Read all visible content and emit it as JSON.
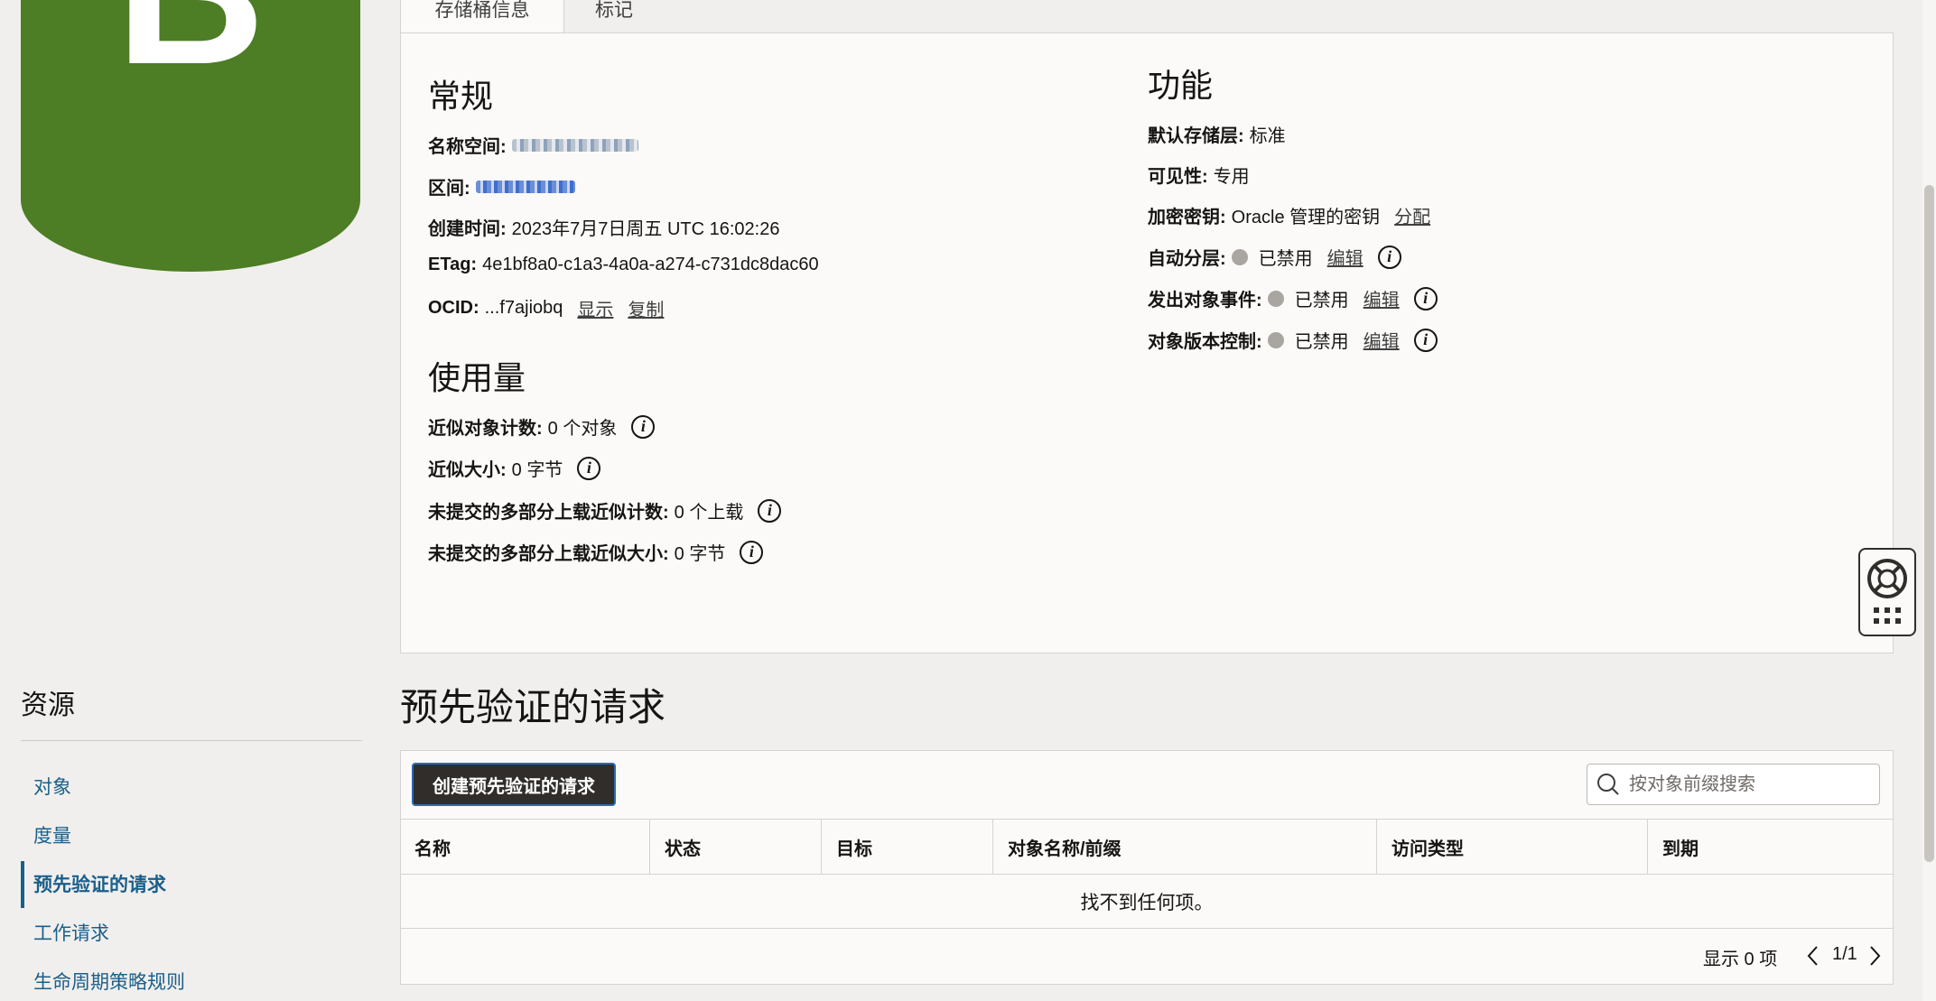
{
  "logo": {
    "letter": "B",
    "color": "#4d7d24"
  },
  "tabs": [
    {
      "label": "存储桶信息",
      "active": true
    },
    {
      "label": "标记",
      "active": false
    }
  ],
  "general": {
    "heading": "常规",
    "namespace_label": "名称空间:",
    "compartment_label": "区间:",
    "created_label": "创建时间:",
    "created_value": "2023年7月7日周五 UTC 16:02:26",
    "etag_label": "ETag:",
    "etag_value": "4e1bf8a0-c1a3-4a0a-a274-c731dc8dac60",
    "ocid_label": "OCID:",
    "ocid_value": "...f7ajiobq",
    "show_link": "显示",
    "copy_link": "复制"
  },
  "usage": {
    "heading": "使用量",
    "object_count_label": "近似对象计数:",
    "object_count_value": "0 个对象",
    "size_label": "近似大小:",
    "size_value": "0 字节",
    "multipart_count_label": "未提交的多部分上载近似计数:",
    "multipart_count_value": "0 个上载",
    "multipart_size_label": "未提交的多部分上载近似大小:",
    "multipart_size_value": "0 字节"
  },
  "features": {
    "heading": "功能",
    "storage_tier_label": "默认存储层:",
    "storage_tier_value": "标准",
    "visibility_label": "可见性:",
    "visibility_value": "专用",
    "encryption_label": "加密密钥:",
    "encryption_value": "Oracle 管理的密钥",
    "assign_link": "分配",
    "auto_tiering_label": "自动分层:",
    "auto_tiering_value": "已禁用",
    "events_label": "发出对象事件:",
    "events_value": "已禁用",
    "versioning_label": "对象版本控制:",
    "versioning_value": "已禁用",
    "edit_link": "编辑"
  },
  "resources": {
    "title": "资源",
    "items": [
      {
        "label": "对象"
      },
      {
        "label": "度量"
      },
      {
        "label": "预先验证的请求",
        "active": true
      },
      {
        "label": "工作请求"
      },
      {
        "label": "生命周期策略规则"
      }
    ]
  },
  "par": {
    "title": "预先验证的请求",
    "create_button": "创建预先验证的请求",
    "search_placeholder": "按对象前缀搜索",
    "columns": [
      "名称",
      "状态",
      "目标",
      "对象名称/前缀",
      "访问类型",
      "到期"
    ],
    "empty_text": "找不到任何项。",
    "count_text": "显示 0 项",
    "page_text": "1/1"
  }
}
